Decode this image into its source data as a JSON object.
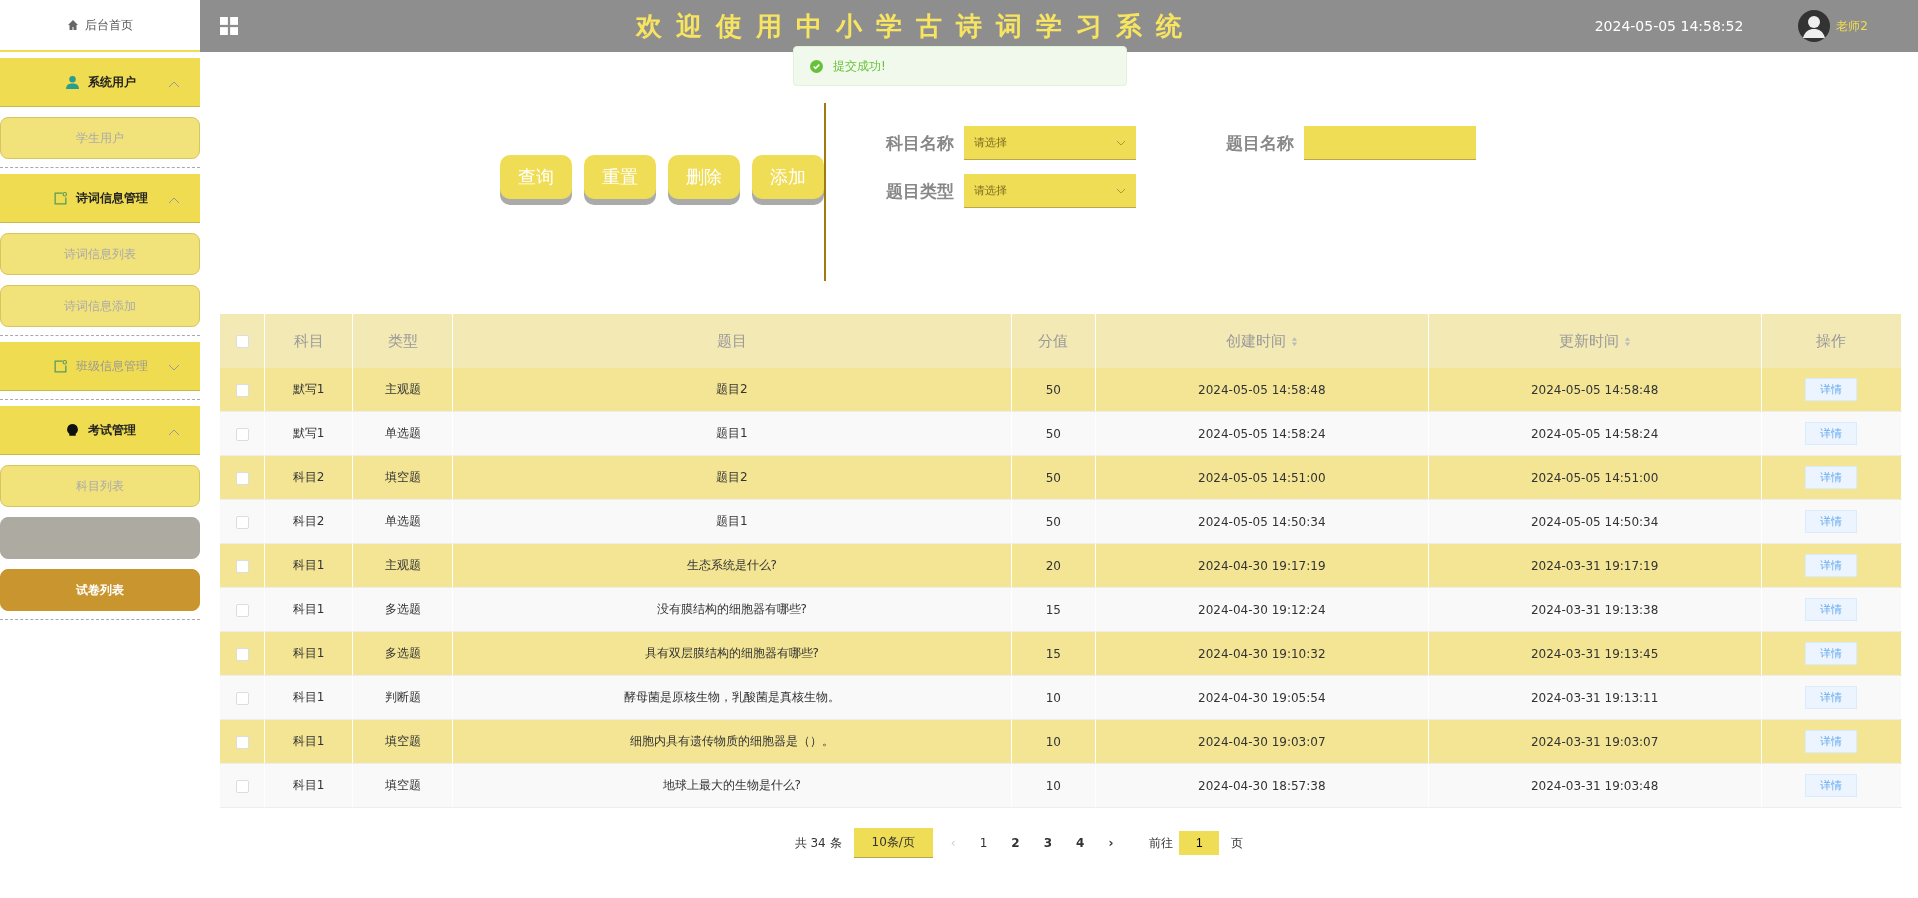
{
  "sidebar": {
    "home": "后台首页",
    "groups": [
      {
        "title": "系统用户",
        "kind": "user",
        "expanded": true,
        "disabled": false,
        "items": [
          {
            "label": "学生用户",
            "selected": false,
            "hovered": false
          }
        ]
      },
      {
        "title": "诗词信息管理",
        "kind": "note",
        "expanded": true,
        "disabled": false,
        "items": [
          {
            "label": "诗词信息列表",
            "selected": false,
            "hovered": false
          },
          {
            "label": "诗词信息添加",
            "selected": false,
            "hovered": false
          }
        ]
      },
      {
        "title": "班级信息管理",
        "kind": "note",
        "expanded": false,
        "disabled": true
      },
      {
        "title": "考试管理",
        "kind": "bulb",
        "expanded": true,
        "disabled": false,
        "items": [
          {
            "label": "科目列表",
            "selected": false,
            "hovered": false
          },
          {
            "selected": false,
            "hovered": true
          },
          {
            "label": "试卷列表",
            "selected": true,
            "hovered": false
          }
        ]
      }
    ]
  },
  "header": {
    "title": "欢迎使用中小学古诗词学习系统",
    "datetime": "2024-05-05 14:58:52",
    "user": "老师2"
  },
  "toast": {
    "message": "提交成功!"
  },
  "actions": [
    "查询",
    "重置",
    "删除",
    "添加"
  ],
  "filters": [
    {
      "label": "科目名称",
      "kind": "select",
      "placeholder": "请选择"
    },
    {
      "label": "题目名称",
      "kind": "input"
    },
    {
      "label": "题目类型",
      "kind": "select",
      "placeholder": "请选择"
    }
  ],
  "table": {
    "all_checked": false,
    "columns": [
      {
        "title": "科目",
        "sortable": false
      },
      {
        "title": "类型",
        "sortable": false
      },
      {
        "title": "题目",
        "sortable": false
      },
      {
        "title": "分值",
        "sortable": false
      },
      {
        "title": "创建时间",
        "sortable": true
      },
      {
        "title": "更新时间",
        "sortable": true
      },
      {
        "title": "操作",
        "sortable": false
      }
    ],
    "rows": [
      {
        "cells": [
          "默写1",
          "主观题",
          "题目2",
          "50",
          "2024-05-05 14:58:48",
          "2024-05-05 14:58:48"
        ],
        "action": "详情",
        "checked": false
      },
      {
        "cells": [
          "默写1",
          "单选题",
          "题目1",
          "50",
          "2024-05-05 14:58:24",
          "2024-05-05 14:58:24"
        ],
        "action": "详情",
        "checked": false
      },
      {
        "cells": [
          "科目2",
          "填空题",
          "题目2",
          "50",
          "2024-05-05 14:51:00",
          "2024-05-05 14:51:00"
        ],
        "action": "详情",
        "checked": false
      },
      {
        "cells": [
          "科目2",
          "单选题",
          "题目1",
          "50",
          "2024-05-05 14:50:34",
          "2024-05-05 14:50:34"
        ],
        "action": "详情",
        "checked": false
      },
      {
        "cells": [
          "科目1",
          "主观题",
          "生态系统是什么?",
          "20",
          "2024-04-30 19:17:19",
          "2024-03-31 19:17:19"
        ],
        "action": "详情",
        "checked": false
      },
      {
        "cells": [
          "科目1",
          "多选题",
          "没有膜结构的细胞器有哪些?",
          "15",
          "2024-04-30 19:12:24",
          "2024-03-31 19:13:38"
        ],
        "action": "详情",
        "checked": false
      },
      {
        "cells": [
          "科目1",
          "多选题",
          "具有双层膜结构的细胞器有哪些?",
          "15",
          "2024-04-30 19:10:32",
          "2024-03-31 19:13:45"
        ],
        "action": "详情",
        "checked": false
      },
      {
        "cells": [
          "科目1",
          "判断题",
          "酵母菌是原核生物，乳酸菌是真核生物。",
          "10",
          "2024-04-30 19:05:54",
          "2024-03-31 19:13:11"
        ],
        "action": "详情",
        "checked": false
      },
      {
        "cells": [
          "科目1",
          "填空题",
          "细胞内具有遗传物质的细胞器是（）。",
          "10",
          "2024-04-30 19:03:07",
          "2024-03-31 19:03:07"
        ],
        "action": "详情",
        "checked": false
      },
      {
        "cells": [
          "科目1",
          "填空题",
          "地球上最大的生物是什么?",
          "10",
          "2024-04-30 18:57:38",
          "2024-03-31 19:03:48"
        ],
        "action": "详情",
        "checked": false
      }
    ]
  },
  "pagination": {
    "total": "共 34 条",
    "page_size": "10条/页",
    "prev": "‹",
    "pages": [
      {
        "label": "1",
        "selected": true
      },
      {
        "label": "2",
        "selected": false
      },
      {
        "label": "3",
        "selected": false
      },
      {
        "label": "4",
        "selected": false
      }
    ],
    "next": "›",
    "goto": "前往",
    "goto_value": "1",
    "page_unit": "页"
  }
}
